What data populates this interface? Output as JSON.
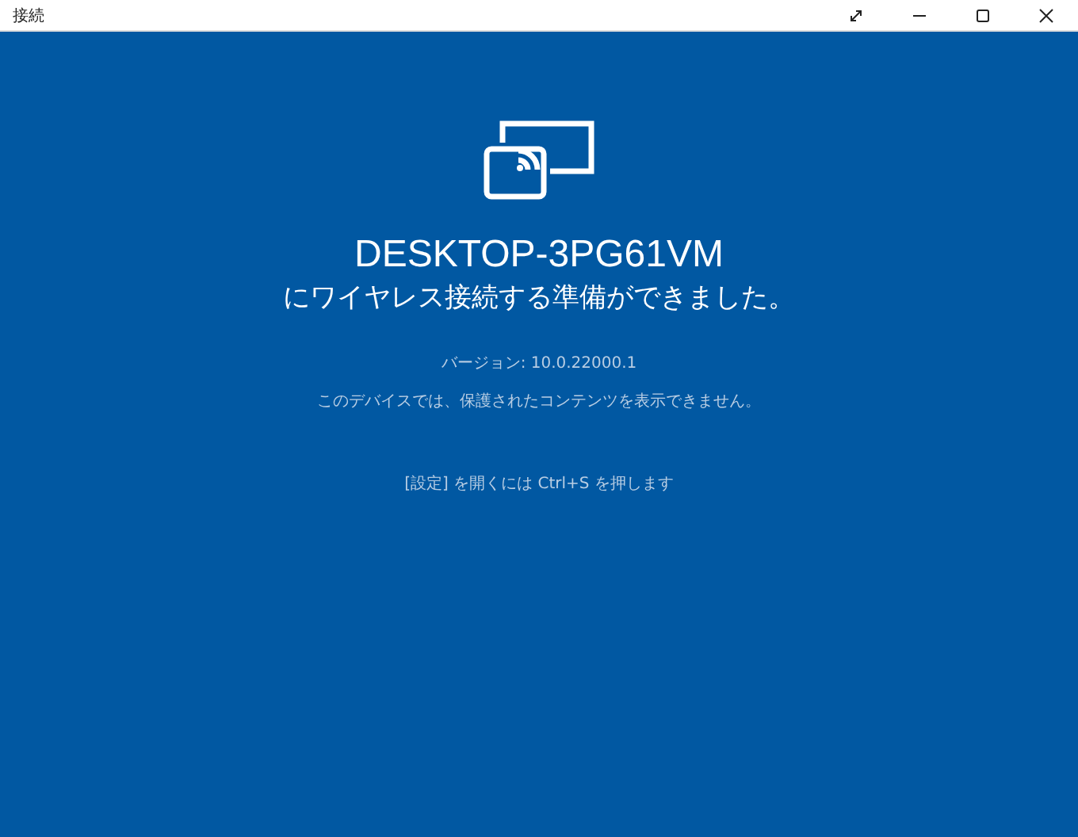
{
  "window": {
    "title": "接続"
  },
  "main": {
    "device_name": "DESKTOP-3PG61VM",
    "status": "にワイヤレス接続する準備ができました。",
    "version": "バージョン: 10.0.22000.1",
    "notice": "このデバイスでは、保護されたコンテンツを表示できません。",
    "hint": "[設定] を開くには Ctrl+S を押します"
  }
}
